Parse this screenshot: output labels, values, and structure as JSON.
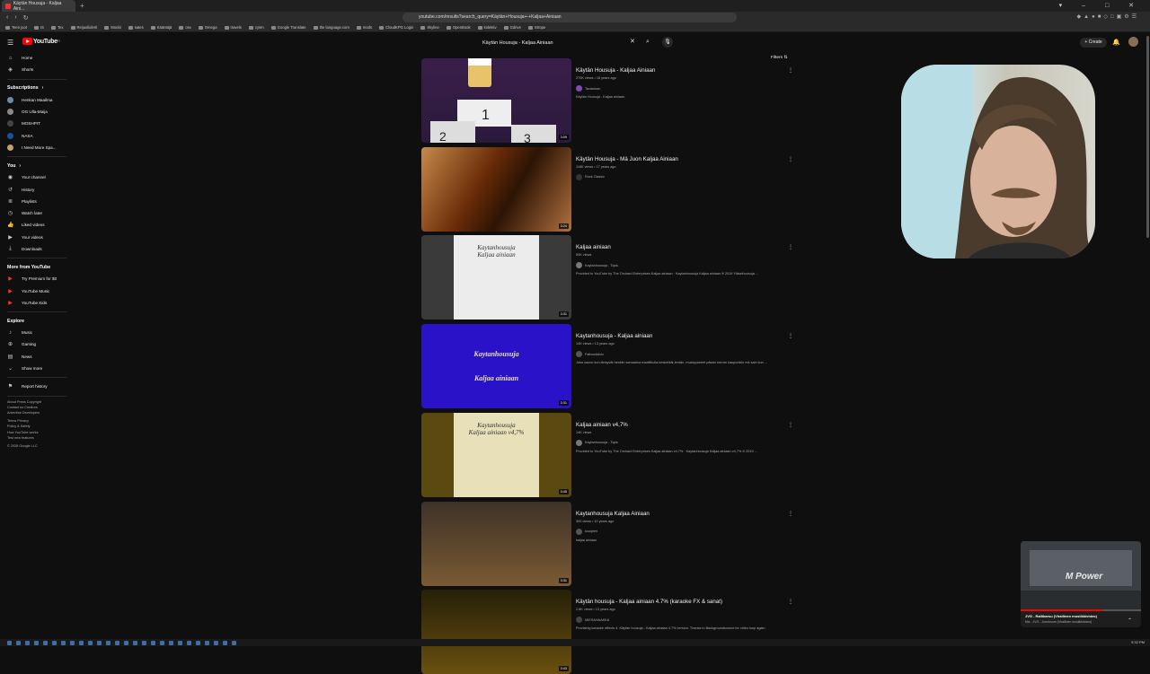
{
  "browser": {
    "tab_title": "Käytän Housuja - Kaljaa Aini...",
    "url": "youtube.com/results?search_query=Käytän+Housuja+-+Kaljaa+Ainiaan",
    "bookmarks": [
      "Teen juot",
      "IS",
      "Tex",
      "Reijuoliiderti",
      "Moobi",
      "sates",
      "Kääntäjä",
      "osx",
      "Omega",
      "travels",
      "cysm",
      "Google Translate",
      "the language.com",
      "mods",
      "CloudKPG Login",
      "Skyline",
      "OpenBook",
      "kolektiv",
      "Gdrive",
      "Strope"
    ]
  },
  "header": {
    "logo_text": "YouTube",
    "logo_region": "FI",
    "search_value": "Käytän Housuja - Kaljaa Ainiaan",
    "create_label": "Create"
  },
  "sidebar": {
    "main": [
      {
        "icon": "home-icon",
        "glyph": "⌂",
        "label": "Home"
      },
      {
        "icon": "shorts-icon",
        "glyph": "◈",
        "label": "Shorts"
      }
    ],
    "subscriptions_title": "Subscriptions",
    "subscriptions": [
      {
        "label": "Henkan Maailma",
        "color": "#6a8caa"
      },
      {
        "label": "OG Ulla-Maija",
        "color": "#8a8a8a"
      },
      {
        "label": "MOSHPIT",
        "color": "#444444"
      },
      {
        "label": "NASA",
        "color": "#1b4fa0"
      },
      {
        "label": "I Need More Spa...",
        "color": "#c2a070"
      }
    ],
    "you_title": "You",
    "you": [
      {
        "icon": "your-channel-icon",
        "glyph": "◉",
        "label": "Your channel"
      },
      {
        "icon": "history-icon",
        "glyph": "↺",
        "label": "History"
      },
      {
        "icon": "playlists-icon",
        "glyph": "≣",
        "label": "Playlists"
      },
      {
        "icon": "watch-later-icon",
        "glyph": "◷",
        "label": "Watch later"
      },
      {
        "icon": "liked-videos-icon",
        "glyph": "👍",
        "label": "Liked videos"
      },
      {
        "icon": "your-videos-icon",
        "glyph": "▶",
        "label": "Your videos"
      },
      {
        "icon": "downloads-icon",
        "glyph": "⤓",
        "label": "Downloads"
      }
    ],
    "more_title": "More from YouTube",
    "more": [
      {
        "icon": "premium-icon",
        "label": "Try Premium for $0"
      },
      {
        "icon": "music-icon",
        "label": "YouTube Music"
      },
      {
        "icon": "kids-icon",
        "label": "YouTube Kids"
      }
    ],
    "explore_title": "Explore",
    "explore": [
      {
        "icon": "music-note-icon",
        "glyph": "♪",
        "label": "Music"
      },
      {
        "icon": "gaming-icon",
        "glyph": "⊕",
        "label": "Gaming"
      },
      {
        "icon": "news-icon",
        "glyph": "▤",
        "label": "News"
      },
      {
        "icon": "chevron-down-icon",
        "glyph": "⌄",
        "label": "Show more"
      }
    ],
    "report": {
      "icon": "flag-icon",
      "glyph": "⚑",
      "label": "Report history"
    },
    "footer": [
      "About  Press  Copyright",
      "Contact us  Creators",
      "Advertise  Developers",
      "",
      "Terms  Privacy",
      "Policy & Safety",
      "How YouTube works",
      "Test new features",
      "",
      "© 2026 Google LLC"
    ]
  },
  "filters_label": "Filters",
  "videos": [
    {
      "title": "Käytän Housuja - Kaljaa Ainiaan",
      "meta": "270K views • 18 years ago",
      "channel": "Tavastoan",
      "desc": "Käytän Housuja - Kaljaa ainiaan.",
      "duration": "3:09",
      "thumb": "t1",
      "chan_color": "#7d4bb5"
    },
    {
      "title": "Käytän Housuja - Mä Juon Kaljaa Ainiaan",
      "meta": "118K views • 17 years ago",
      "channel": "Rock Classic",
      "desc": "",
      "duration": "3:24",
      "thumb": "t2",
      "chan_color": "#333333"
    },
    {
      "title": "Kaljaa ainiaan",
      "meta": "50K views",
      "channel": "Kaytanhousuja - Topic",
      "desc": "Provided to YouTube by The Orchard Enterprises Kaljaa ainiaan · Kaytanhousuja Kaljaa ainiaan ℗ 2019 Ylässihousuja ...",
      "duration": "3:31",
      "thumb": "t3",
      "chan_color": "#777777"
    },
    {
      "title": "Kaytanhousuja - Kaljaa ainiaan",
      "meta": "14K views • 13 years ago",
      "channel": "FatboxAdvix",
      "desc": "Joka saunu kun länsyvät herdän samaatoa maailtkulla-keskeläät-lentän- musiopaneet pässin kerran kaupunkiin mä sain kun ...",
      "duration": "3:31",
      "thumb": "t4",
      "chan_color": "#555555"
    },
    {
      "title": "Kaljaa ainiaan v4,7%",
      "meta": "14K views",
      "channel": "Kaytanhousuja - Topic",
      "desc": "Provided to YouTube by The Orchard Enterprises Kaljaa ainiaan v4,7% · Kaytanhousuja Kaljaa ainiaan v4,7% ℗ 2019 ...",
      "duration": "3:45",
      "thumb": "t5",
      "chan_color": "#777777"
    },
    {
      "title": "Kaytanhousuja Kaljaa Ainiaan",
      "meta": "300 views • 12 years ago",
      "channel": "kouiptmi",
      "desc": "kaljaa ainiaan",
      "duration": "3:31",
      "thumb": "t6",
      "chan_color": "#555555"
    },
    {
      "title": "Käytän housuja - Kaljaa ainiaan 4.7% (karaoke FX & sanat)",
      "meta": "2.8K views • 13 years ago",
      "channel": "MIESAHAAKKA",
      "desc": "Provisinig karaoke effects 4. Käytän housuja - Kaljaa ainiaan 4.7% version. Thanks to Backgroundsource for video loop again.",
      "duration": "3:43",
      "thumb": "t7",
      "chan_color": "#444444"
    }
  ],
  "thumb_texts": {
    "t3": [
      "Kaytanhousuja",
      "Kaljaa ainiaan"
    ],
    "t4": [
      "Kaytanhousuja",
      "Kaljaa ainiaan"
    ],
    "t5": [
      "Kaytanhousuja",
      "Kaljaa ainiaan v4,7%"
    ]
  },
  "miniplayer": {
    "brand_text": "M Power",
    "title": "JVG - Rallikarsu (Virallinen musiikkivideo)",
    "subtitle": "Mix - JVG - Jonnhoom (Virallinen musiikkivideo)"
  },
  "clock": "9:32 PM"
}
